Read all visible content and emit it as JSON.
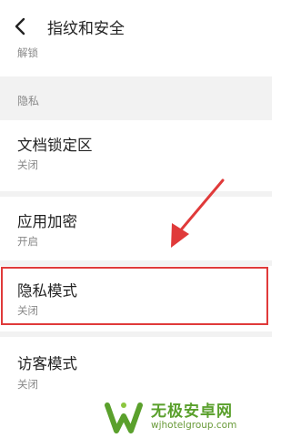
{
  "header": {
    "title": "指纹和安全",
    "back_icon": "chevron-left-icon"
  },
  "partial_item": {
    "subtitle": "解锁"
  },
  "section": {
    "label": "隐私"
  },
  "items": [
    {
      "title": "文档锁定区",
      "status": "关闭"
    },
    {
      "title": "应用加密",
      "status": "开启"
    },
    {
      "title": "隐私模式",
      "status": "关闭"
    },
    {
      "title": "访客模式",
      "status": "关闭"
    }
  ],
  "annotation": {
    "highlight_color": "#e03a3a",
    "arrow_color": "#e03a3a"
  },
  "watermark": {
    "name": "无极安卓网",
    "url": "wjhotelgroup.com",
    "logo_icon": "w-logo-icon"
  }
}
